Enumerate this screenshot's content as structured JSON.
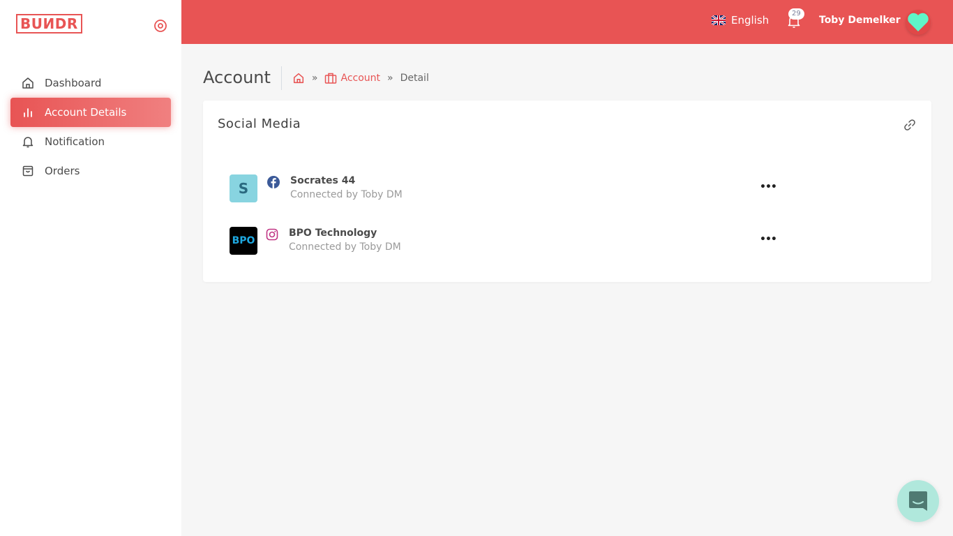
{
  "brand": {
    "logo_text": "BUИDR",
    "accent": "#e85454"
  },
  "sidebar": {
    "items": [
      {
        "label": "Dashboard",
        "icon": "home-icon",
        "active": false
      },
      {
        "label": "Account Details",
        "icon": "bar-chart-icon",
        "active": true
      },
      {
        "label": "Notification",
        "icon": "bell-icon",
        "active": false
      },
      {
        "label": "Orders",
        "icon": "shopping-bag-icon",
        "active": false
      }
    ]
  },
  "topbar": {
    "language": "English",
    "notification_count": "29",
    "user_name": "Toby Demelker"
  },
  "page": {
    "title": "Account",
    "breadcrumb": {
      "sep": "»",
      "link": "Account",
      "current": "Detail"
    }
  },
  "card": {
    "title": "Social Media",
    "accounts": [
      {
        "avatar_text": "S",
        "network": "facebook",
        "name": "Socrates 44",
        "subtitle": "Connected by Toby DM",
        "more": "•••"
      },
      {
        "avatar_text": "BPO",
        "network": "instagram",
        "name": "BPO Technology",
        "subtitle": "Connected by Toby DM",
        "more": "•••"
      }
    ]
  }
}
